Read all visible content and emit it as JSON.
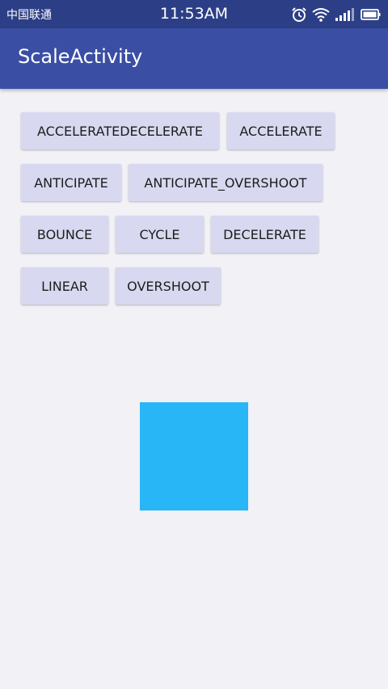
{
  "status_bar": {
    "carrier": "中国联通",
    "time": "11:53AM",
    "icons": [
      "alarm-icon",
      "wifi-icon",
      "signal-icon",
      "battery-icon"
    ],
    "color": "#2c3f86"
  },
  "app_bar": {
    "title": "ScaleActivity",
    "color": "#3a4fa4"
  },
  "buttons": [
    {
      "label": "ACCELERATEDECELERATE"
    },
    {
      "label": "ACCELERATE"
    },
    {
      "label": "ANTICIPATE"
    },
    {
      "label": "ANTICIPATE_OVERSHOOT"
    },
    {
      "label": "BOUNCE"
    },
    {
      "label": "CYCLE"
    },
    {
      "label": "DECELERATE"
    },
    {
      "label": "LINEAR"
    },
    {
      "label": "OVERSHOOT"
    }
  ],
  "colors": {
    "button_bg": "#d8d9f0",
    "square": "#29b6f6",
    "background": "#f1f1f6"
  }
}
